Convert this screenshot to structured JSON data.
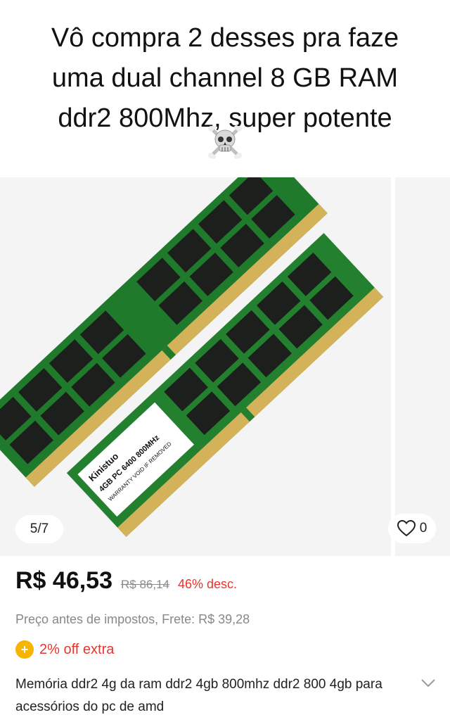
{
  "meme": {
    "caption_line1": "Vô compra 2 desses pra faze",
    "caption_line2": "uma dual channel 8 GB RAM",
    "caption_line3": "ddr2 800Mhz, super potente",
    "emoji": "skull-and-crossbones"
  },
  "gallery": {
    "counter": "5/7",
    "favorites_count": "0",
    "module_label_line1": "Kinistuo",
    "module_label_line2": "4GB PC 6400 800MHz",
    "module_label_line3": "WARRANTY VOID IF REMOVED"
  },
  "product": {
    "price": "R$ 46,53",
    "original_price": "R$ 86,14",
    "discount": "46% desc.",
    "tax_note": "Preço antes de impostos, Frete: R$ 39,28",
    "coupon_text": "2% off extra",
    "title": "Memória ddr2 4g da ram ddr2 4gb 800mhz ddr2 800 4gb para acessórios do pc de amd"
  },
  "colors": {
    "price_red": "#e6362d",
    "coin_yellow": "#f6b500",
    "pcb_green": "#1f7a2c",
    "chip_black": "#1c1f1c",
    "pin_gold": "#d4b25a"
  }
}
